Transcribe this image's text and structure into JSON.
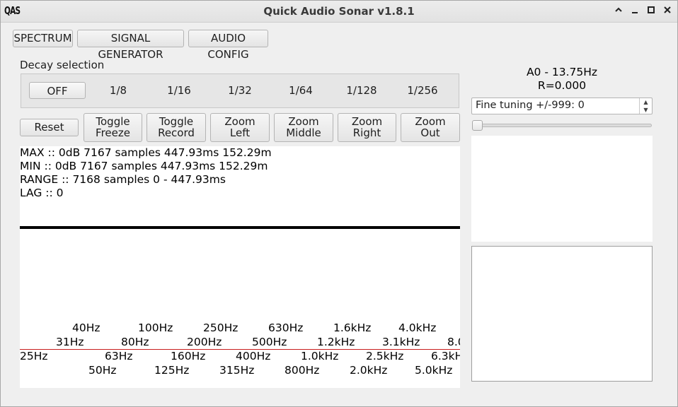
{
  "window": {
    "app_icon_text": "QAS",
    "title": "Quick Audio Sonar v1.8.1",
    "controls": {
      "maximize_glyph": "^",
      "minimize_glyph": "_",
      "restore_glyph": "□",
      "close_glyph": "✕"
    }
  },
  "tabs": [
    {
      "label": "SPECTRUM"
    },
    {
      "label": "SIGNAL GENERATOR"
    },
    {
      "label": "AUDIO CONFIG"
    }
  ],
  "decay": {
    "label": "Decay selection",
    "options": [
      "OFF",
      "1/8",
      "1/16",
      "1/32",
      "1/64",
      "1/128",
      "1/256"
    ],
    "selected": "OFF"
  },
  "controls": {
    "reset": "Reset",
    "toggle_freeze": [
      "Toggle",
      "Freeze"
    ],
    "toggle_record": [
      "Toggle",
      "Record"
    ],
    "zoom_left": [
      "Zoom",
      "Left"
    ],
    "zoom_middle": [
      "Zoom",
      "Middle"
    ],
    "zoom_right": [
      "Zoom",
      "Right"
    ],
    "zoom_out": [
      "Zoom",
      "Out"
    ]
  },
  "stats": {
    "max": "MAX :: 0dB 7167 samples 447.93ms 152.29m",
    "min": "MIN :: 0dB 7167 samples 447.93ms 152.29m",
    "range": "RANGE :: 7168 samples 0 - 447.93ms",
    "lag": "LAG :: 0"
  },
  "frequency_axis": {
    "row1": [
      "40Hz",
      "100Hz",
      "250Hz",
      "630Hz",
      "1.6kHz",
      "4.0kHz"
    ],
    "row2": [
      "31Hz",
      "80Hz",
      "200Hz",
      "500Hz",
      "1.2kHz",
      "3.1kHz",
      "8.0"
    ],
    "row3": [
      "25Hz",
      "63Hz",
      "160Hz",
      "400Hz",
      "1.0kHz",
      "2.5kHz",
      "6.3kH"
    ],
    "row4": [
      "50Hz",
      "125Hz",
      "315Hz",
      "800Hz",
      "2.0kHz",
      "5.0kHz"
    ]
  },
  "note_panel": {
    "note": "A0 - 13.75Hz",
    "ratio": "R=0.000"
  },
  "fine_tuning": {
    "value_text": "Fine tuning +/-999: 0",
    "slider_fraction": 0.0
  },
  "colors": {
    "axis_line": "#c81e1e",
    "signal_line": "#000000",
    "background": "#efefef"
  }
}
